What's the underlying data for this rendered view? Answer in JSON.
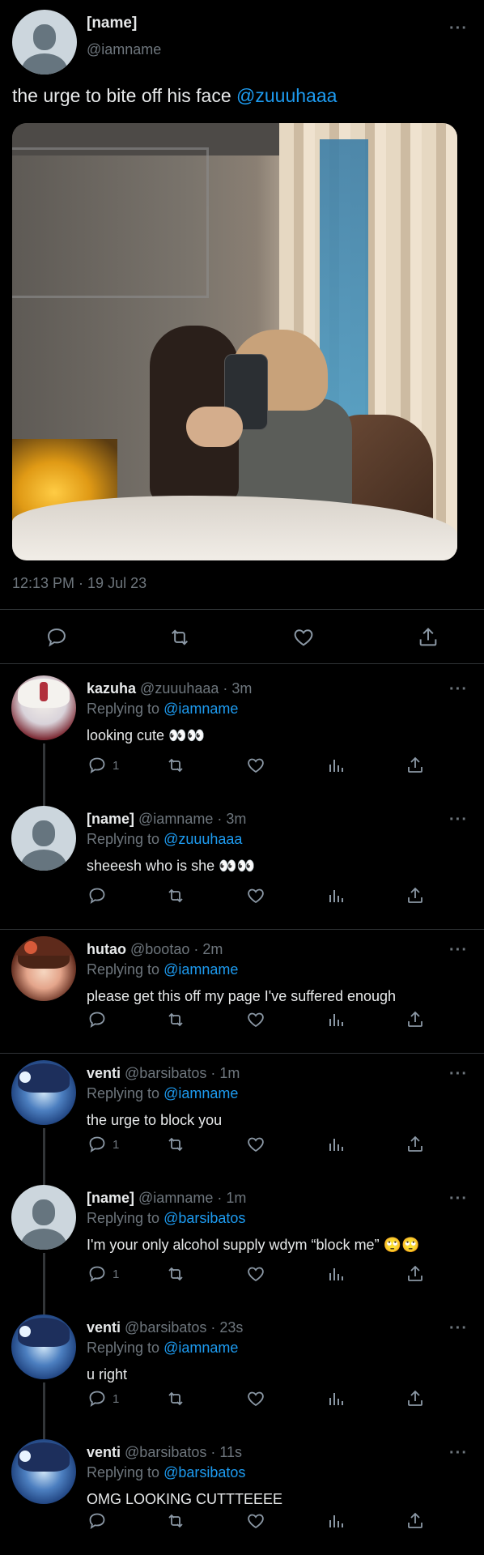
{
  "main": {
    "display_name": "[name]",
    "handle": "@iamname",
    "text": "the urge to bite off his face ",
    "mention": "@zuuuhaaa",
    "timestamp": "12:13 PM · 19 Jul 23"
  },
  "replies": [
    {
      "name": "kazuha",
      "handle": "@zuuuhaaa",
      "time": "· 3m",
      "replying_label": "Replying to ",
      "replying_to": "@iamname",
      "text": "looking cute 👀👀",
      "reply_count": "1",
      "avatar": "kazuha-avatar"
    },
    {
      "name": "[name]",
      "handle": "@iamname",
      "time": "· 3m",
      "replying_label": "Replying to ",
      "replying_to": "@zuuuhaaa",
      "text": "sheeesh who is she 👀👀",
      "reply_count": "",
      "avatar": "default-avatar"
    },
    {
      "name": "hutao",
      "handle": "@bootao",
      "time": "· 2m",
      "replying_label": "Replying to ",
      "replying_to": "@iamname",
      "text": "please get this off my page I've suffered enough",
      "reply_count": "",
      "avatar": "hutao-avatar"
    },
    {
      "name": "venti",
      "handle": "@barsibatos",
      "time": "· 1m",
      "replying_label": "Replying to ",
      "replying_to": "@iamname",
      "text": "the urge to block you",
      "reply_count": "1",
      "avatar": "venti-avatar"
    },
    {
      "name": "[name]",
      "handle": "@iamname",
      "time": "· 1m",
      "replying_label": "Replying to ",
      "replying_to": "@barsibatos",
      "text": "I'm your only alcohol supply wdym “block me” 🙄🙄",
      "reply_count": "1",
      "avatar": "default-avatar"
    },
    {
      "name": "venti",
      "handle": "@barsibatos",
      "time": "· 23s",
      "replying_label": "Replying to ",
      "replying_to": "@iamname",
      "text": "u right",
      "reply_count": "1",
      "avatar": "venti-avatar"
    },
    {
      "name": "venti",
      "handle": "@barsibatos",
      "time": "· 11s",
      "replying_label": "Replying to ",
      "replying_to": "@barsibatos",
      "text": "OMG LOOKING CUTTTEEEE",
      "reply_count": "",
      "avatar": "venti-avatar"
    }
  ],
  "colors": {
    "background": "#000000",
    "accent": "#1d9bf0",
    "muted": "#6e767d",
    "text": "#e7e9ea",
    "divider": "#2f3336"
  }
}
